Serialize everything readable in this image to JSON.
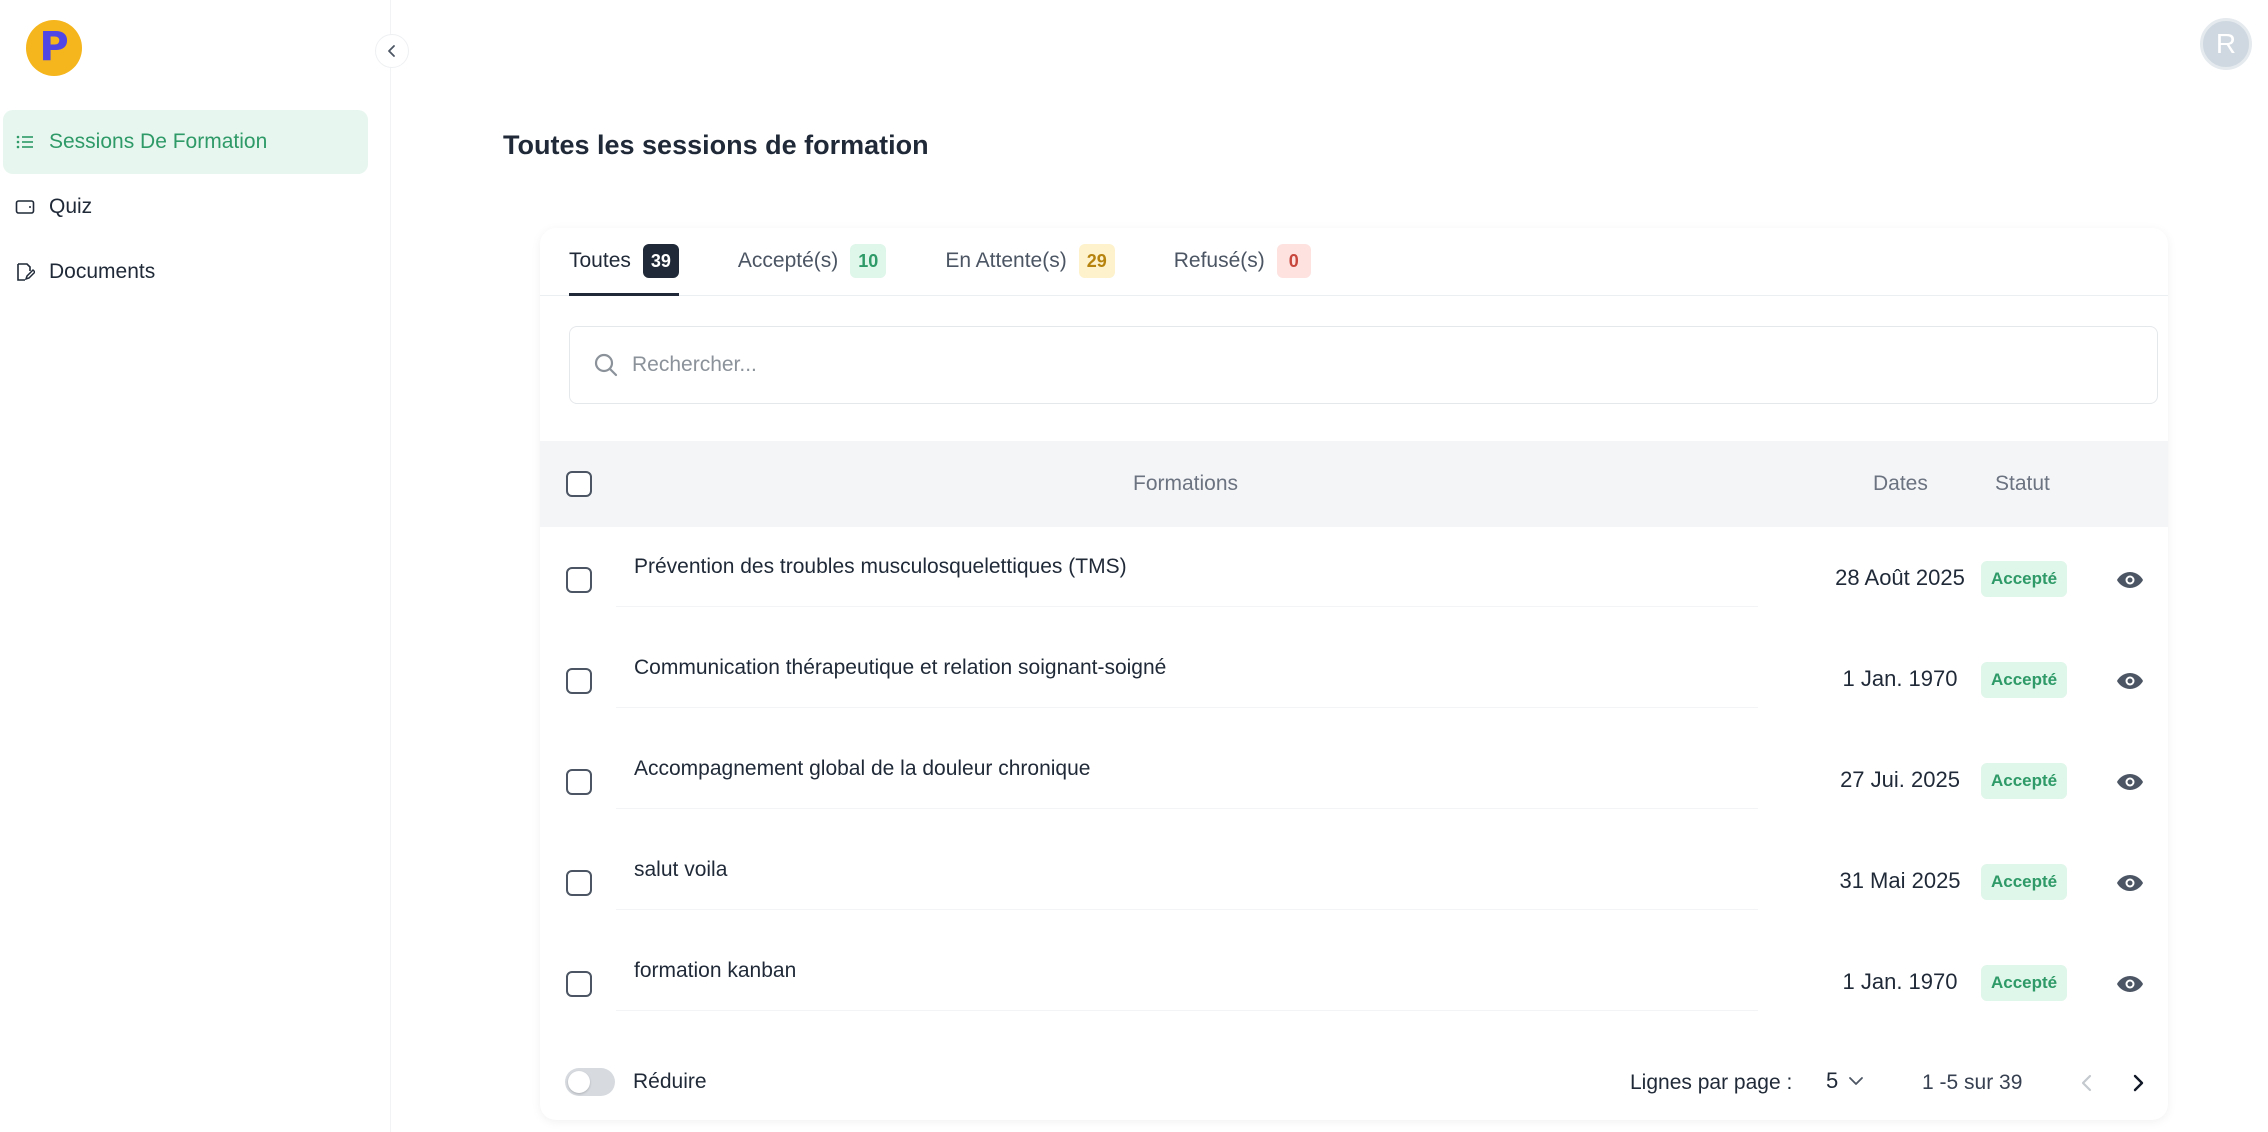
{
  "app": {
    "logo_letter": "P",
    "user_initial": "R"
  },
  "sidebar": {
    "items": [
      {
        "label": "Sessions De Formation",
        "icon": "list-icon",
        "active": true
      },
      {
        "label": "Quiz",
        "icon": "tablet-icon",
        "active": false
      },
      {
        "label": "Documents",
        "icon": "document-edit-icon",
        "active": false
      }
    ]
  },
  "page": {
    "title": "Toutes les sessions de formation"
  },
  "tabs": [
    {
      "label": "Toutes",
      "count": "39",
      "active": true
    },
    {
      "label": "Accepté(s)",
      "count": "10",
      "active": false
    },
    {
      "label": "En Attente(s)",
      "count": "29",
      "active": false
    },
    {
      "label": "Refusé(s)",
      "count": "0",
      "active": false
    }
  ],
  "search": {
    "placeholder": "Rechercher..."
  },
  "table": {
    "headers": {
      "formations": "Formations",
      "dates": "Dates",
      "statut": "Statut"
    },
    "rows": [
      {
        "name": "Prévention des troubles musculosquelettiques (TMS)",
        "date": "28 Août 2025",
        "status": "Accepté"
      },
      {
        "name": "Communication thérapeutique et relation soignant-soigné",
        "date": "1 Jan. 1970",
        "status": "Accepté"
      },
      {
        "name": "Accompagnement global de la douleur chronique",
        "date": "27 Jui. 2025",
        "status": "Accepté"
      },
      {
        "name": "salut voila",
        "date": "31 Mai 2025",
        "status": "Accepté"
      },
      {
        "name": "formation kanban",
        "date": "1 Jan. 1970",
        "status": "Accepté"
      }
    ]
  },
  "footer": {
    "reduire_label": "Réduire",
    "rows_per_page_label": "Lignes par page :",
    "rows_per_page_value": "5",
    "range_label": "1 -5 sur 39"
  },
  "colors": {
    "accent_green": "#2e9a67",
    "active_bg": "#e7f6ef",
    "logo_bg": "#f5b51c",
    "logo_letter": "#4f46e5"
  }
}
